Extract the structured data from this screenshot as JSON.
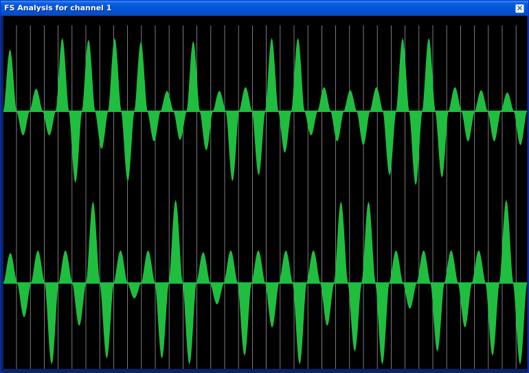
{
  "window": {
    "title": "FS Analysis for channel 1",
    "close_icon": "close-icon"
  },
  "colors": {
    "background": "#000000",
    "waveform": "#1fbe3f",
    "gridline": "#9a9a9a",
    "titlebar": "#0454d6"
  },
  "chart_data": [
    {
      "type": "area",
      "grid": true,
      "cycles": [
        {
          "pos": 0.82,
          "neg": -0.32
        },
        {
          "pos": 0.3,
          "neg": -0.32
        },
        {
          "pos": 0.97,
          "neg": -0.95
        },
        {
          "pos": 0.95,
          "neg": -0.5
        },
        {
          "pos": 0.97,
          "neg": -0.93
        },
        {
          "pos": 0.92,
          "neg": -0.4
        },
        {
          "pos": 0.27,
          "neg": -0.38
        },
        {
          "pos": 0.93,
          "neg": -0.52
        },
        {
          "pos": 0.27,
          "neg": -0.93
        },
        {
          "pos": 0.32,
          "neg": -0.85
        },
        {
          "pos": 0.97,
          "neg": -0.55
        },
        {
          "pos": 0.97,
          "neg": -0.32
        },
        {
          "pos": 0.32,
          "neg": -0.4
        },
        {
          "pos": 0.28,
          "neg": -0.45
        },
        {
          "pos": 0.32,
          "neg": -0.85
        },
        {
          "pos": 0.97,
          "neg": -0.98
        },
        {
          "pos": 0.97,
          "neg": -0.88
        },
        {
          "pos": 0.32,
          "neg": -0.4
        },
        {
          "pos": 0.28,
          "neg": -0.4
        },
        {
          "pos": 0.25,
          "neg": -0.45
        }
      ]
    },
    {
      "type": "area",
      "grid": true,
      "cycles": [
        {
          "pos": 0.35,
          "neg": -0.4
        },
        {
          "pos": 0.38,
          "neg": -0.95
        },
        {
          "pos": 0.38,
          "neg": -0.5
        },
        {
          "pos": 0.95,
          "neg": -0.88
        },
        {
          "pos": 0.38,
          "neg": -0.18
        },
        {
          "pos": 0.38,
          "neg": -0.88
        },
        {
          "pos": 0.97,
          "neg": -0.95
        },
        {
          "pos": 0.36,
          "neg": -0.25
        },
        {
          "pos": 0.38,
          "neg": -0.85
        },
        {
          "pos": 0.38,
          "neg": -0.52
        },
        {
          "pos": 0.38,
          "neg": -0.95
        },
        {
          "pos": 0.38,
          "neg": -0.5
        },
        {
          "pos": 0.95,
          "neg": -0.8
        },
        {
          "pos": 0.95,
          "neg": -0.95
        },
        {
          "pos": 0.38,
          "neg": -0.3
        },
        {
          "pos": 0.38,
          "neg": -0.8
        },
        {
          "pos": 0.38,
          "neg": -0.52
        },
        {
          "pos": 0.38,
          "neg": -0.85
        },
        {
          "pos": 0.97,
          "neg": -0.95
        }
      ]
    }
  ]
}
